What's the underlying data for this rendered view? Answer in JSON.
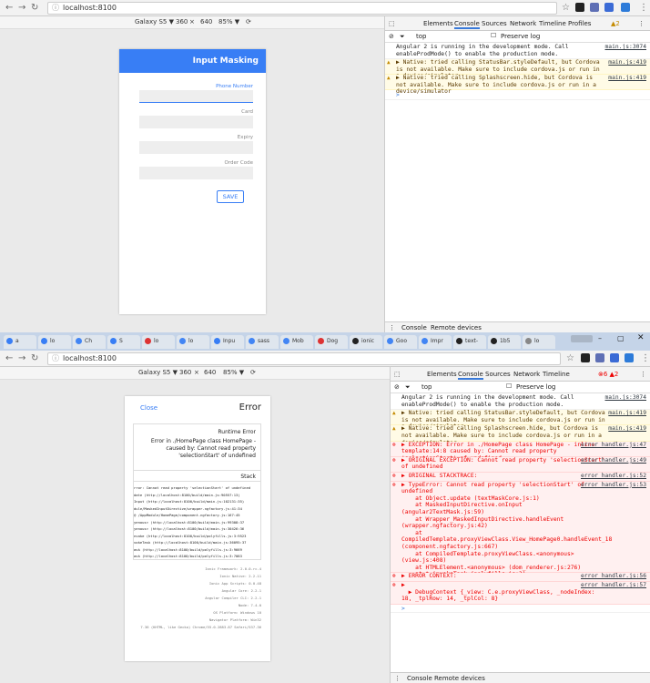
{
  "top": {
    "url": "localhost:8100",
    "device": {
      "name": "Galaxy S5 ▼",
      "width": "360",
      "x": "×",
      "height": "640",
      "zoom": "85% ▼"
    },
    "app": {
      "title": "Input Masking",
      "fields": [
        "Phone Number",
        "Card",
        "Expiry",
        "Order Code"
      ],
      "save": "SAVE"
    },
    "devtools": {
      "tabs": [
        "Elements",
        "Console",
        "Sources",
        "Network",
        "Timeline",
        "Profiles"
      ],
      "warn_count": "▲2",
      "filter": {
        "context": "top",
        "preserve": "Preserve log"
      },
      "console": [
        {
          "type": "info",
          "text": "Angular 2 is running in the development mode. Call enableProdMode() to enable the production mode.",
          "src": "main.js:3074"
        },
        {
          "type": "warn",
          "text": "▶ Native: tried calling StatusBar.styleDefault, but Cordova is not available. Make sure to include cordova.js or run in a device/simulator",
          "src": "main.js:419"
        },
        {
          "type": "warn",
          "text": "▶ Native: tried calling Splashscreen.hide, but Cordova is not available. Make sure to include cordova.js or run in a device/simulator",
          "src": "main.js:419"
        }
      ],
      "prompt": ">",
      "drawer": [
        "Console",
        "Remote devices"
      ]
    }
  },
  "bottom": {
    "tabs": [
      "a",
      "lo",
      "Ch",
      "S",
      "lo",
      "lo",
      "Inpu",
      "sass",
      "Mob",
      "Dog",
      "ionic",
      "Goo",
      "Impr",
      "text-",
      "1b5",
      "lo"
    ],
    "url": "localhost:8100",
    "device": {
      "name": "Galaxy S5 ▼",
      "width": "360",
      "x": "×",
      "height": "640",
      "zoom": "85% ▼"
    },
    "error": {
      "close": "Close",
      "title": "Error",
      "runtime": "Runtime Error",
      "message": "Error in ./HomePage class HomePage - caused by: Cannot read property 'selectionStart' of undefined",
      "stack_label": "Stack",
      "stack": [
        "rror: Cannot read property 'selectionStart' of undefined",
        "date (http://localhost:8100/build/main.js:90557:13)",
        "Input (http://localhost:8100/build/main.js:102131:35)",
        "dule/MaskedInputDirective/wrapper.ngfactory.js:41:34",
        "@ /AppModule/HomePage/component.ngfactory.js:167:45",
        "yenous> (http://localhost:8100/build/main.js:99308:37",
        "yenous> (http://localhost:8100/build/main.js:30426:36",
        "nvoke (http://localhost:8100/build/polyfills.js:3:9523",
        "vokeTask (http://localhost:8100/build/main.js:36095:37",
        "ask (http://localhost:8100/build/polyfills.js:3:9669",
        "ask (http://localhost:8100/build/polyfills.js:3:7083"
      ],
      "info": [
        "Ionic Framework: 2.0.0-rc.4",
        "Ionic Native: 2.2.11",
        "Ionic App Scripts: 0.0.48",
        "Angular Core: 2.2.1",
        "Angular Compiler CLI: 2.2.1",
        "Node: 7.4.0",
        "OS Platform: Windows 10",
        "Navigator Platform: Win32",
        "7.36 (KHTML, like Gecko) Chrome/55.0.2883.87 Safari/537.36"
      ]
    },
    "devtools": {
      "tabs": [
        "Elements",
        "Console",
        "Sources",
        "Network",
        "Timeline"
      ],
      "counts": "⊗6 ▲2",
      "filter": {
        "context": "top",
        "preserve": "Preserve log"
      },
      "console": [
        {
          "type": "info",
          "text": "Angular 2 is running in the development mode. Call enableProdMode() to enable the production mode.",
          "src": "main.js:3074",
          "h": 2
        },
        {
          "type": "warn",
          "text": "▶ Native: tried calling StatusBar.styleDefault, but Cordova is not available. Make sure to include cordova.js or run in a device/simulator",
          "src": "main.js:419",
          "h": 2
        },
        {
          "type": "warn",
          "text": "▶ Native: tried calling Splashscreen.hide, but Cordova is not available. Make sure to include cordova.js or run in a device/simulator",
          "src": "main.js:419",
          "h": 2
        },
        {
          "type": "err",
          "text": "▶ EXCEPTION: Error in ./HomePage class HomePage - inline template:14:8 caused by: Cannot read property 'selectionStart' of undefined",
          "src": "error_handler.js:47",
          "h": 2
        },
        {
          "type": "err",
          "text": "▶ ORIGINAL EXCEPTION: Cannot read property 'selectionStart' of undefined",
          "src": "error_handler.js:49",
          "h": 2
        },
        {
          "type": "err",
          "text": "▶ ORIGINAL STACKTRACE:",
          "src": "error_handler.js:52",
          "h": 1
        },
        {
          "type": "err",
          "text": "▶ TypeError: Cannot read property 'selectionStart' of undefined\n    at Object.update (textMaskCore.js:1)\n    at MaskedInputDirective.onInput (angular2TextMask.js:59)\n    at Wrapper_MaskedInputDirective.handleEvent (wrapper.ngfactory.js:42)\n    at CompiledTemplate.proxyViewClass.View_HomePage0.handleEvent_18 (component.ngfactory.js:667)\n    at CompiledTemplate.proxyViewClass.<anonymous> (view.js:408)\n    at HTMLElement.<anonymous> (dom_renderer.js:276)\n    at t.invokeTask (polyfills.js:3)\n    at Object.onInvokeTask (ng_zone.js:227)\n    at t.invokeTask (polyfills.js:3)\n    at e.runTask (polyfills.js:3)",
          "src": "error_handler.js:53",
          "h": 13
        },
        {
          "type": "err",
          "text": "▶ ERROR CONTEXT:",
          "src": "error_handler.js:56",
          "h": 1
        },
        {
          "type": "err",
          "text": "▶\n  ▶ DebugContext {_view: C.e.proxyViewClass, _nodeIndex: 18, _tplRow: 14, _tplCol: 8}",
          "src": "error_handler.js:57",
          "h": 3
        }
      ],
      "prompt": ">",
      "drawer": [
        "Console",
        "Remote devices"
      ]
    }
  },
  "colors": {
    "ionic_blue": "#387ef5",
    "error_red": "#e00"
  }
}
